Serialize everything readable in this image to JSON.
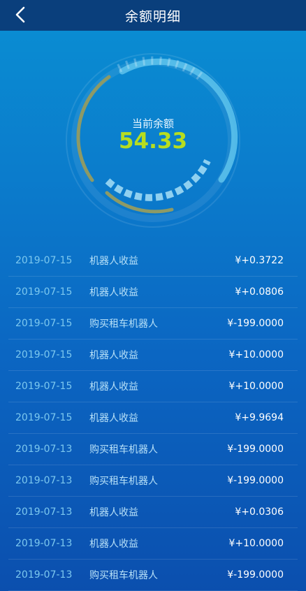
{
  "header": {
    "title": "余额明细",
    "back_icon": "chevron-left-icon"
  },
  "balance": {
    "label": "当前余额",
    "value": "54.33"
  },
  "colors": {
    "accent_value": "#b7dd20",
    "header_bg": "#0a3f7c"
  },
  "records": [
    {
      "date": "2019-07-15",
      "desc": "机器人收益",
      "amount": "¥+0.3722"
    },
    {
      "date": "2019-07-15",
      "desc": "机器人收益",
      "amount": "¥+0.0806"
    },
    {
      "date": "2019-07-15",
      "desc": "购买租车机器人",
      "amount": "¥-199.0000"
    },
    {
      "date": "2019-07-15",
      "desc": "机器人收益",
      "amount": "¥+10.0000"
    },
    {
      "date": "2019-07-15",
      "desc": "机器人收益",
      "amount": "¥+10.0000"
    },
    {
      "date": "2019-07-15",
      "desc": "机器人收益",
      "amount": "¥+9.9694"
    },
    {
      "date": "2019-07-13",
      "desc": "购买租车机器人",
      "amount": "¥-199.0000"
    },
    {
      "date": "2019-07-13",
      "desc": "购买租车机器人",
      "amount": "¥-199.0000"
    },
    {
      "date": "2019-07-13",
      "desc": "机器人收益",
      "amount": "¥+0.0306"
    },
    {
      "date": "2019-07-13",
      "desc": "机器人收益",
      "amount": "¥+10.0000"
    },
    {
      "date": "2019-07-13",
      "desc": "购买租车机器人",
      "amount": "¥-199.0000"
    }
  ]
}
